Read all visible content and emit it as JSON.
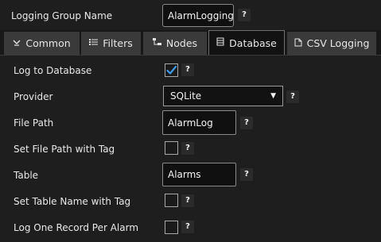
{
  "header": {
    "group_name_label": "Logging Group Name",
    "group_name_value": "AlarmLogging",
    "help": "?"
  },
  "tabs": [
    {
      "label": "Common",
      "icon": "common-icon",
      "active": false
    },
    {
      "label": "Filters",
      "icon": "filters-icon",
      "active": false
    },
    {
      "label": "Nodes",
      "icon": "nodes-icon",
      "active": false
    },
    {
      "label": "Database",
      "icon": "database-icon",
      "active": true
    },
    {
      "label": "CSV Logging",
      "icon": "csv-icon",
      "active": false
    }
  ],
  "form": {
    "log_to_database": {
      "label": "Log to Database",
      "checked": true
    },
    "provider": {
      "label": "Provider",
      "value": "SQLite"
    },
    "file_path": {
      "label": "File Path",
      "value": "AlarmLog"
    },
    "set_file_path_with_tag": {
      "label": "Set File Path with Tag",
      "checked": false
    },
    "table": {
      "label": "Table",
      "value": "Alarms"
    },
    "set_table_name_with_tag": {
      "label": "Set Table Name with Tag",
      "checked": false
    },
    "log_one_record_per_alarm": {
      "label": "Log One Record Per Alarm",
      "checked": false
    }
  },
  "colors": {
    "background": "#1e1e1e",
    "tab_background": "#3a3a3a",
    "check_accent": "#3d9be9"
  }
}
